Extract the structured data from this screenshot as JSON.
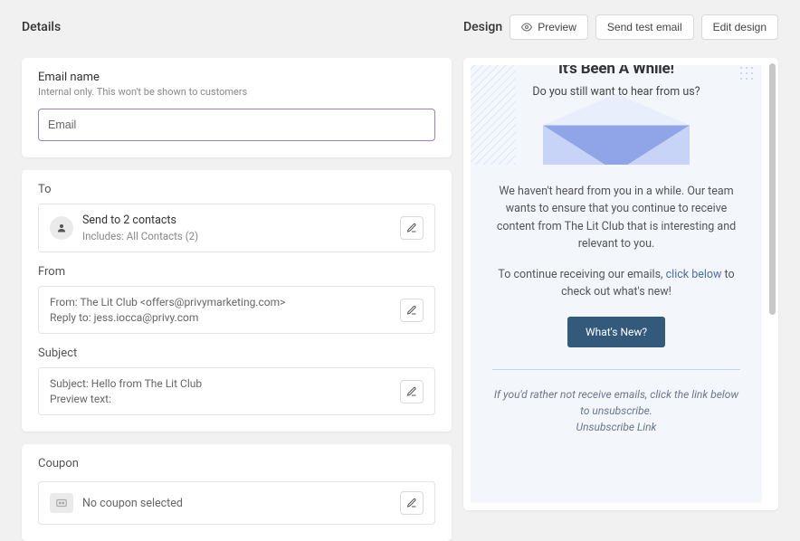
{
  "left": {
    "title": "Details",
    "email_name": {
      "label": "Email name",
      "helper": "Internal only. This won't be shown to customers",
      "placeholder": "Email",
      "value": "Email"
    },
    "to": {
      "label": "To",
      "line1": "Send to 2 contacts",
      "line2": "Includes: All Contacts (2)"
    },
    "from": {
      "label": "From",
      "line1": "From: The Lit Club <offers@privymarketing.com>",
      "line2": "Reply to: jess.iocca@privy.com"
    },
    "subject": {
      "label": "Subject",
      "line1": "Subject: Hello from The Lit Club",
      "line2": "Preview text:"
    },
    "coupon": {
      "label": "Coupon",
      "line1": "No coupon selected"
    }
  },
  "right": {
    "title": "Design",
    "buttons": {
      "preview": "Preview",
      "send_test": "Send test email",
      "edit": "Edit design"
    },
    "email": {
      "headline": "It's Been A While!",
      "subhead": "Do you still want to hear from us?",
      "body1": "We haven't heard from you in a while. Our team wants to ensure that you continue to receive content from The Lit Club that is interesting and relevant to you.",
      "body2_a": "To continue receiving our emails, ",
      "body2_b": "click below",
      "body2_c": " to check out what's new!",
      "cta": "What's New?",
      "footer1": "If you'd rather not receive emails, click the link below to unsubscribe.",
      "footer2": "Unsubscribe Link"
    }
  }
}
